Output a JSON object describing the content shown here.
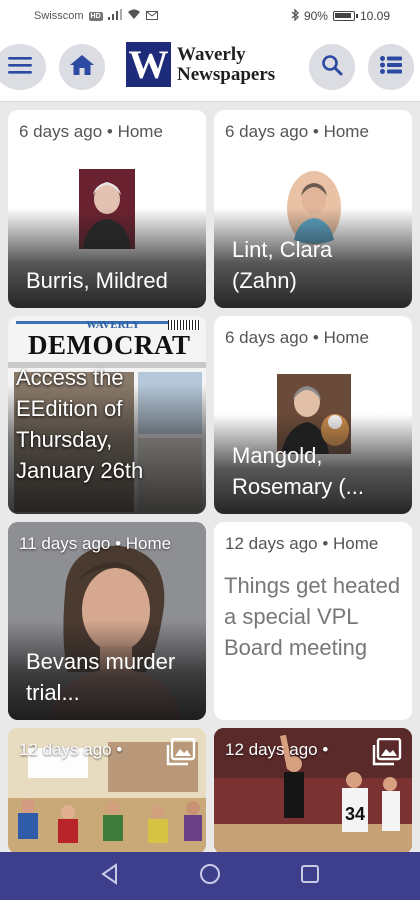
{
  "status_bar": {
    "carrier": "Swisscom",
    "carrier_tag": "HD",
    "battery": "90%",
    "time": "10.09"
  },
  "header": {
    "logo_letter": "W",
    "logo_line1": "Waverly",
    "logo_line2": "Newspapers"
  },
  "cards": [
    {
      "meta": "6 days ago • Home",
      "title": "Burris, Mildred"
    },
    {
      "meta": "6 days ago • Home",
      "title": "Lint, Clara (Zahn)"
    },
    {
      "paper_masthead_top": "WAVERLY",
      "paper_masthead": "DEMOCRAT",
      "title": "Access the EEdition of Thursday, January 26th"
    },
    {
      "meta": "6 days ago • Home",
      "title": "Mangold, Rosemary (..."
    },
    {
      "meta": "11 days ago • Home",
      "title": "Bevans murder trial..."
    },
    {
      "meta": "12 days ago • Home",
      "title": "Things get heated a special VPL Board meeting"
    },
    {
      "meta": "12 days ago •"
    },
    {
      "meta": "12 days ago •",
      "jersey_number": "34"
    }
  ],
  "colors": {
    "brand_navy": "#1e2b7a",
    "icon_blue": "#2d4aa3",
    "nav_bar": "#3d3f8c"
  }
}
